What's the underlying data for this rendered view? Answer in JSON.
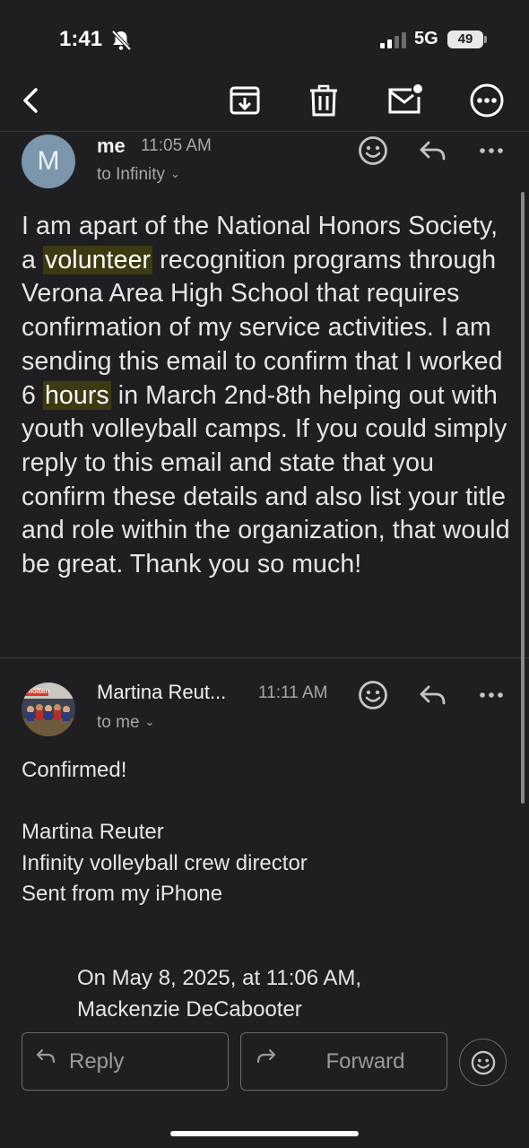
{
  "status_bar": {
    "time": "1:41",
    "network": "5G",
    "battery": "49"
  },
  "toolbar": {
    "icons": [
      "back-icon",
      "archive-icon",
      "trash-icon",
      "mark-unread-icon",
      "more-icon"
    ]
  },
  "messages": [
    {
      "avatar_letter": "M",
      "sender": "me",
      "time": "11:05 AM",
      "recipient": "to Infinity",
      "body_parts": [
        "I am apart of the National Honors Society, a ",
        "volunteer",
        " recognition programs through Verona Area High School that requires confirmation of my service activities. I am sending this email to confirm that I worked 6 ",
        "hours",
        " in March 2nd-8th helping out with youth volleyball camps. If you could simply reply to this email and state that you confirm these details and also list your title and role within the organization, that would be great. Thank you so much!"
      ]
    },
    {
      "avatar_text": "molten",
      "sender": "Martina Reut...",
      "time": "11:11 AM",
      "recipient": "to me",
      "body_lines": [
        "Confirmed!",
        "",
        "Martina Reuter",
        "Infinity volleyball crew director",
        "Sent from my iPhone"
      ],
      "quote_lines": [
        "On May 8, 2025, at 11:06 AM,",
        "Mackenzie DeCabooter"
      ]
    }
  ],
  "actions": {
    "reply": "Reply",
    "forward": "Forward"
  },
  "colors": {
    "background": "#1f1f21",
    "highlight": "#3d3a12",
    "avatar": "#7b96ad"
  }
}
